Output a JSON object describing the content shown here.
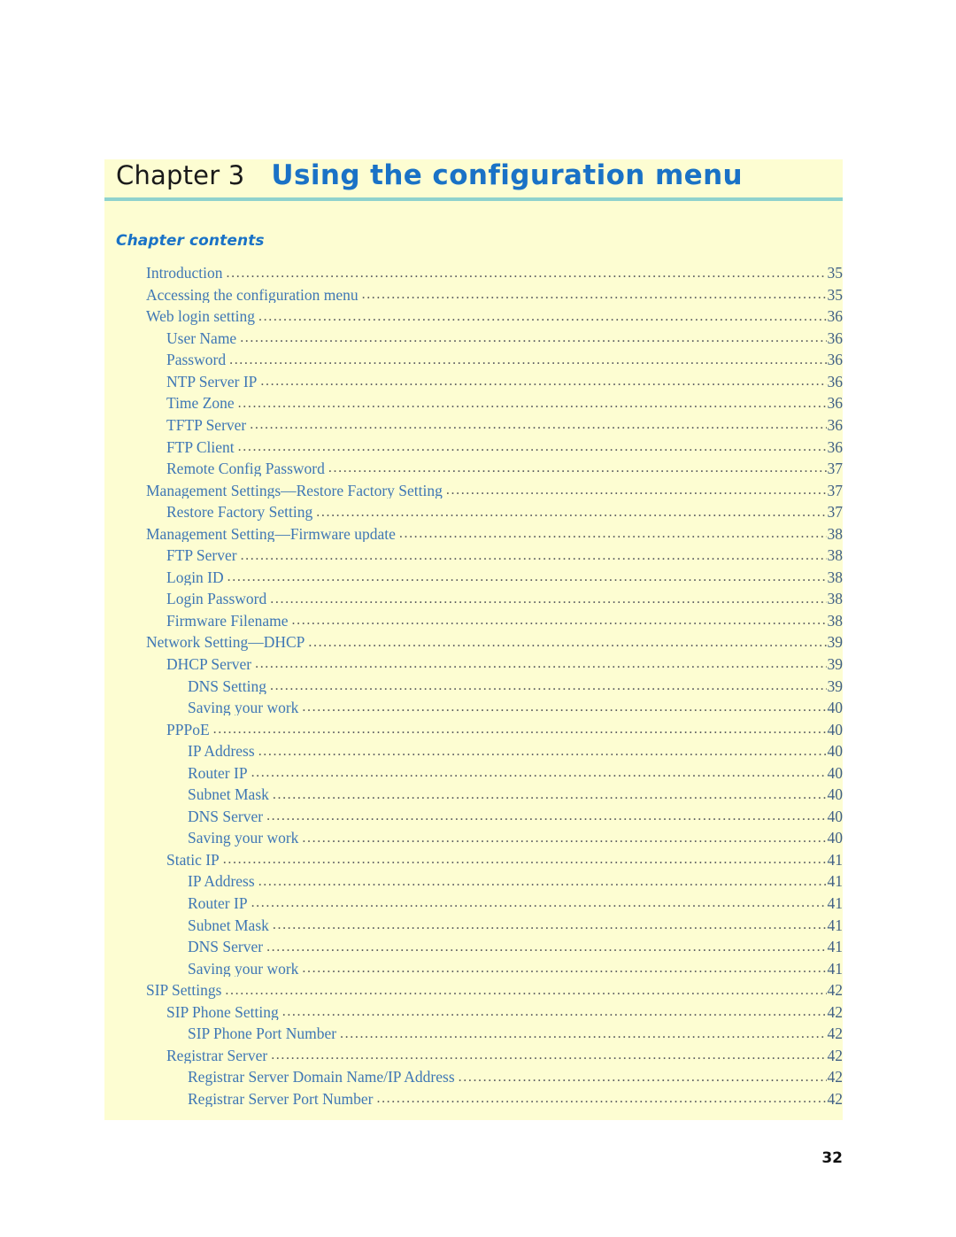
{
  "page": {
    "folio": "32",
    "background_color": "#ffffff",
    "panel_color": "#fdfdd2",
    "accent_blue": "#1a72c6",
    "toc_blue": "#3f77b5",
    "rule_color": "#8fd2cd"
  },
  "chapter": {
    "label": "Chapter 3",
    "title": "Using the configuration menu"
  },
  "contents": {
    "heading": "Chapter contents",
    "entries": [
      {
        "label": "Introduction",
        "page": "35",
        "level": 0
      },
      {
        "label": "Accessing the configuration menu",
        "page": "35",
        "level": 0
      },
      {
        "label": "Web login setting",
        "page": "36",
        "level": 0
      },
      {
        "label": "User Name",
        "page": "36",
        "level": 1
      },
      {
        "label": "Password",
        "page": "36",
        "level": 1
      },
      {
        "label": "NTP Server IP",
        "page": "36",
        "level": 1
      },
      {
        "label": "Time Zone",
        "page": "36",
        "level": 1
      },
      {
        "label": "TFTP Server",
        "page": "36",
        "level": 1
      },
      {
        "label": "FTP Client",
        "page": "36",
        "level": 1
      },
      {
        "label": "Remote Config Password",
        "page": "37",
        "level": 1
      },
      {
        "label": "Management Settings—Restore Factory Setting",
        "page": "37",
        "level": 0
      },
      {
        "label": "Restore Factory Setting",
        "page": "37",
        "level": 1
      },
      {
        "label": "Management Setting—Firmware update",
        "page": "38",
        "level": 0
      },
      {
        "label": "FTP Server",
        "page": "38",
        "level": 1
      },
      {
        "label": "Login ID",
        "page": "38",
        "level": 1
      },
      {
        "label": "Login Password",
        "page": "38",
        "level": 1
      },
      {
        "label": "Firmware Filename",
        "page": "38",
        "level": 1
      },
      {
        "label": "Network Setting—DHCP",
        "page": "39",
        "level": 0
      },
      {
        "label": "DHCP Server",
        "page": "39",
        "level": 1
      },
      {
        "label": "DNS Setting",
        "page": "39",
        "level": 2
      },
      {
        "label": "Saving your work",
        "page": "40",
        "level": 2
      },
      {
        "label": "PPPoE",
        "page": "40",
        "level": 1
      },
      {
        "label": "IP Address",
        "page": "40",
        "level": 2
      },
      {
        "label": "Router IP",
        "page": "40",
        "level": 2
      },
      {
        "label": "Subnet Mask",
        "page": "40",
        "level": 2
      },
      {
        "label": "DNS Server",
        "page": "40",
        "level": 2
      },
      {
        "label": "Saving your work",
        "page": "40",
        "level": 2
      },
      {
        "label": "Static IP",
        "page": "41",
        "level": 1
      },
      {
        "label": "IP Address",
        "page": "41",
        "level": 2
      },
      {
        "label": "Router IP",
        "page": "41",
        "level": 2
      },
      {
        "label": "Subnet Mask",
        "page": "41",
        "level": 2
      },
      {
        "label": "DNS Server",
        "page": "41",
        "level": 2
      },
      {
        "label": "Saving your work",
        "page": "41",
        "level": 2
      },
      {
        "label": "SIP Settings",
        "page": "42",
        "level": 0
      },
      {
        "label": "SIP Phone Setting",
        "page": "42",
        "level": 1
      },
      {
        "label": "SIP Phone Port Number",
        "page": "42",
        "level": 2
      },
      {
        "label": "Registrar Server",
        "page": "42",
        "level": 1
      },
      {
        "label": "Registrar Server Domain Name/IP Address",
        "page": "42",
        "level": 2
      },
      {
        "label": "Registrar Server Port Number",
        "page": "42",
        "level": 2
      }
    ]
  }
}
